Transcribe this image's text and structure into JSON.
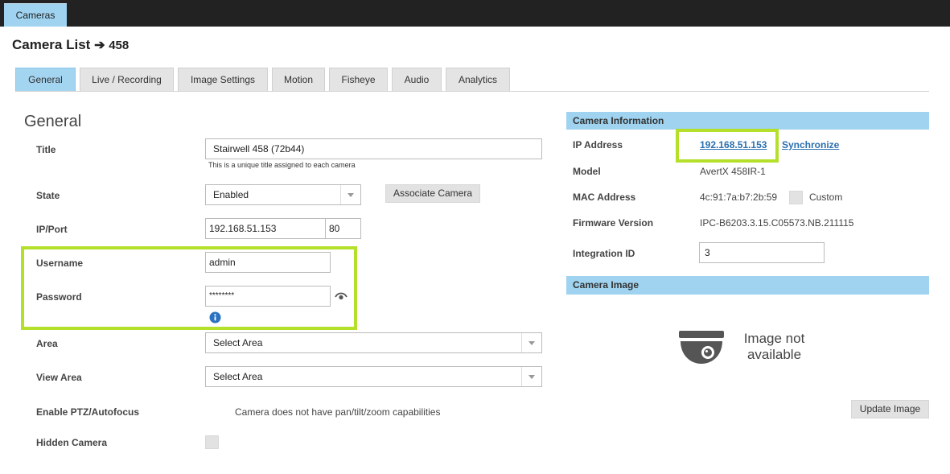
{
  "topbar": {
    "tab_label": "Cameras"
  },
  "header": {
    "title": "Camera List",
    "arrow": "➔",
    "camera_number": "458"
  },
  "tabs": [
    {
      "label": "General"
    },
    {
      "label": "Live / Recording"
    },
    {
      "label": "Image Settings"
    },
    {
      "label": "Motion"
    },
    {
      "label": "Fisheye"
    },
    {
      "label": "Audio"
    },
    {
      "label": "Analytics"
    }
  ],
  "general": {
    "section_title": "General",
    "title_label": "Title",
    "title_value": "Stairwell 458 (72b44)",
    "title_hint": "This is a unique title assigned to each camera",
    "state_label": "State",
    "state_value": "Enabled",
    "associate_button": "Associate Camera",
    "ipport_label": "IP/Port",
    "ip_value": "192.168.51.153",
    "port_value": "80",
    "username_label": "Username",
    "username_value": "admin",
    "password_label": "Password",
    "password_value": "********",
    "area_label": "Area",
    "area_value": "Select Area",
    "view_area_label": "View Area",
    "view_area_value": "Select Area",
    "ptz_label": "Enable PTZ/Autofocus",
    "ptz_text": "Camera does not have pan/tilt/zoom capabilities",
    "hidden_label": "Hidden Camera"
  },
  "camera_info": {
    "heading": "Camera Information",
    "ip_label": "IP Address",
    "ip_link": "192.168.51.153",
    "sync_link": "Synchronize",
    "model_label": "Model",
    "model_value": "AvertX 458IR-1",
    "mac_label": "MAC Address",
    "mac_value": "4c:91:7a:b7:2b:59",
    "custom_label": "Custom",
    "firmware_label": "Firmware Version",
    "firmware_value": "IPC-B6203.3.15.C05573.NB.211115",
    "integration_label": "Integration ID",
    "integration_value": "3"
  },
  "camera_image": {
    "heading": "Camera Image",
    "no_image_line1": "Image not",
    "no_image_line2": "available",
    "update_button": "Update Image"
  },
  "colors": {
    "accent_blue": "#9fd3f0",
    "highlight_green": "#b4e02b",
    "link_blue": "#2a6fb0",
    "topbar": "#222222"
  },
  "icons": [
    "eye-icon",
    "info-icon",
    "dome-camera-icon",
    "dropdown-caret-icon"
  ]
}
